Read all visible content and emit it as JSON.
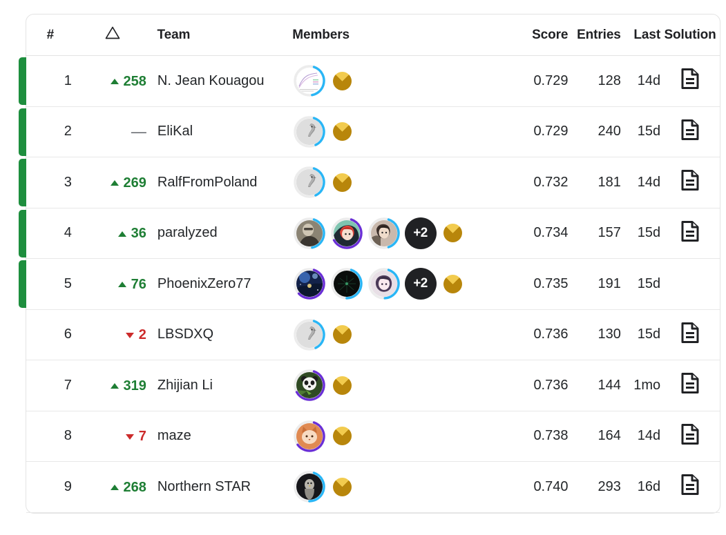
{
  "colors": {
    "rank_marker_green": "#1e8e3e",
    "delta_up_green": "#1e7e34",
    "delta_down_red": "#cc2b2b",
    "medal_gold": "#b8860b",
    "medal_gold_highlight": "#f2cb4e",
    "ring_blue": "#29b6f6",
    "ring_purple": "#6a2fd6",
    "badge_dark": "#202124",
    "border": "#e3e3e3",
    "text": "#232629"
  },
  "table": {
    "columns": [
      {
        "key": "rank",
        "label": "#",
        "name": "column-header-rank"
      },
      {
        "key": "delta",
        "label": "",
        "name": "column-header-delta",
        "icon": "triangle-outline-icon"
      },
      {
        "key": "team",
        "label": "Team",
        "name": "column-header-team"
      },
      {
        "key": "members",
        "label": "Members",
        "name": "column-header-members"
      },
      {
        "key": "score",
        "label": "Score",
        "name": "column-header-score"
      },
      {
        "key": "entries",
        "label": "Entries",
        "name": "column-header-entries"
      },
      {
        "key": "last",
        "label": "Last",
        "name": "column-header-last"
      },
      {
        "key": "solution",
        "label": "Solution",
        "name": "column-header-solution"
      }
    ],
    "header": {
      "rank": "#",
      "team": "Team",
      "members": "Members",
      "score": "Score",
      "entries": "Entries",
      "last": "Last",
      "solution": "Solution"
    },
    "rows": [
      {
        "rank": "1",
        "delta": {
          "value": "258",
          "direction": "up"
        },
        "team": "N. Jean Kouagou",
        "promoted": true,
        "members": [
          {
            "ring": "blue",
            "ring_pct": 42,
            "photo": "chart-thumbnail",
            "bg": "#f2f2f4",
            "fg": "#b79fd4"
          }
        ],
        "more": null,
        "medal": "gold",
        "score": "0.729",
        "entries": "128",
        "last": "14d",
        "solution": true
      },
      {
        "rank": "2",
        "delta": {
          "value": "",
          "direction": "flat"
        },
        "team": "EliKal",
        "promoted": true,
        "members": [
          {
            "ring": "blue",
            "ring_pct": 38,
            "photo": "goose-avatar",
            "bg": "#dddddd",
            "fg": "#8a8a8a"
          }
        ],
        "more": null,
        "medal": "gold",
        "score": "0.729",
        "entries": "240",
        "last": "15d",
        "solution": true
      },
      {
        "rank": "3",
        "delta": {
          "value": "269",
          "direction": "up"
        },
        "team": "RalfFromPoland",
        "promoted": true,
        "members": [
          {
            "ring": "blue",
            "ring_pct": 38,
            "photo": "goose-avatar",
            "bg": "#dddddd",
            "fg": "#8a8a8a"
          }
        ],
        "more": null,
        "medal": "gold",
        "score": "0.732",
        "entries": "181",
        "last": "14d",
        "solution": true
      },
      {
        "rank": "4",
        "delta": {
          "value": "36",
          "direction": "up"
        },
        "team": "paralyzed",
        "promoted": true,
        "members": [
          {
            "ring": "blue",
            "ring_pct": 42,
            "photo": "person-avatar",
            "bg": "#8b8474",
            "fg": "#3a3630"
          },
          {
            "ring": "purple",
            "ring_pct": 62,
            "photo": "anime-red-hair-avatar",
            "bg": "#7fc4b0",
            "fg": "#e0453a"
          },
          {
            "ring": "blue",
            "ring_pct": 40,
            "photo": "anime-dark-avatar",
            "bg": "#c9b9ad",
            "fg": "#3b2f2a"
          }
        ],
        "more": "+2",
        "medal": "gold",
        "score": "0.734",
        "entries": "157",
        "last": "15d",
        "solution": true
      },
      {
        "rank": "5",
        "delta": {
          "value": "76",
          "direction": "up"
        },
        "team": "PhoenixZero77",
        "promoted": true,
        "members": [
          {
            "ring": "purple",
            "ring_pct": 58,
            "photo": "space-scene-avatar",
            "bg": "#2a4b86",
            "fg": "#d8c27a"
          },
          {
            "ring": "blue",
            "ring_pct": 45,
            "photo": "dark-fireworks-avatar",
            "bg": "#0b0f0d",
            "fg": "#1d4a33"
          },
          {
            "ring": "blue",
            "ring_pct": 44,
            "photo": "anime-pale-avatar",
            "bg": "#e8dfe6",
            "fg": "#4c3b59"
          }
        ],
        "more": "+2",
        "medal": "gold",
        "score": "0.735",
        "entries": "191",
        "last": "15d",
        "solution": false
      },
      {
        "rank": "6",
        "delta": {
          "value": "2",
          "direction": "down"
        },
        "team": "LBSDXQ",
        "promoted": false,
        "members": [
          {
            "ring": "blue",
            "ring_pct": 38,
            "photo": "goose-avatar",
            "bg": "#dddddd",
            "fg": "#8a8a8a"
          }
        ],
        "more": null,
        "medal": "gold",
        "score": "0.736",
        "entries": "130",
        "last": "15d",
        "solution": true
      },
      {
        "rank": "7",
        "delta": {
          "value": "319",
          "direction": "up"
        },
        "team": "Zhijian Li",
        "promoted": false,
        "members": [
          {
            "ring": "purple",
            "ring_pct": 62,
            "photo": "panda-avatar",
            "bg": "#2f4a23",
            "fg": "#ffffff"
          }
        ],
        "more": null,
        "medal": "gold",
        "score": "0.736",
        "entries": "144",
        "last": "1mo",
        "solution": true
      },
      {
        "rank": "8",
        "delta": {
          "value": "7",
          "direction": "down"
        },
        "team": "maze",
        "promoted": false,
        "members": [
          {
            "ring": "purple",
            "ring_pct": 60,
            "photo": "cat-avatar",
            "bg": "#e08a52",
            "fg": "#f7dbc2"
          }
        ],
        "more": null,
        "medal": "gold",
        "score": "0.738",
        "entries": "164",
        "last": "14d",
        "solution": true
      },
      {
        "rank": "9",
        "delta": {
          "value": "268",
          "direction": "up"
        },
        "team": "Northern STAR",
        "promoted": false,
        "members": [
          {
            "ring": "blue",
            "ring_pct": 45,
            "photo": "bird-night-avatar",
            "bg": "#16161a",
            "fg": "#b9b5ad"
          }
        ],
        "more": null,
        "medal": "gold",
        "score": "0.740",
        "entries": "293",
        "last": "16d",
        "solution": true
      }
    ]
  }
}
